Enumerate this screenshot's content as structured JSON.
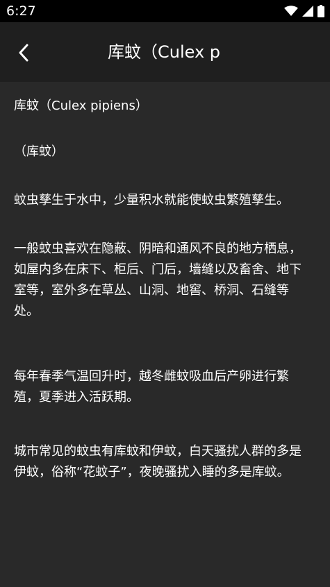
{
  "status_bar": {
    "time": "6:27",
    "icons": [
      "wifi-icon",
      "signal-icon",
      "battery-icon"
    ]
  },
  "app_bar": {
    "back_icon": "chevron-left-icon",
    "title": "库蚊（Culex p"
  },
  "article": {
    "paragraphs": [
      "库蚊（Culex pipiens）",
      "（库蚊）",
      "蚊虫孳生于水中，少量积水就能使蚊虫繁殖孳生。",
      "一般蚊虫喜欢在隐蔽、阴暗和通风不良的地方栖息，如屋内多在床下、柜后、门后，墙缝以及畜舍、地下室等，室外多在草丛、山洞、地窖、桥洞、石缝等处。",
      "每年春季气温回升时，越冬雌蚊吸血后产卵进行繁殖，夏季进入活跃期。",
      "城市常见的蚊虫有库蚊和伊蚊，白天骚扰人群的多是伊蚊，俗称“花蚊子”，夜晚骚扰入睡的多是库蚊。"
    ]
  },
  "colors": {
    "status_bar": "#000000",
    "app_bar": "#1f1f1f",
    "content": "#292929",
    "text": "#ffffff"
  }
}
